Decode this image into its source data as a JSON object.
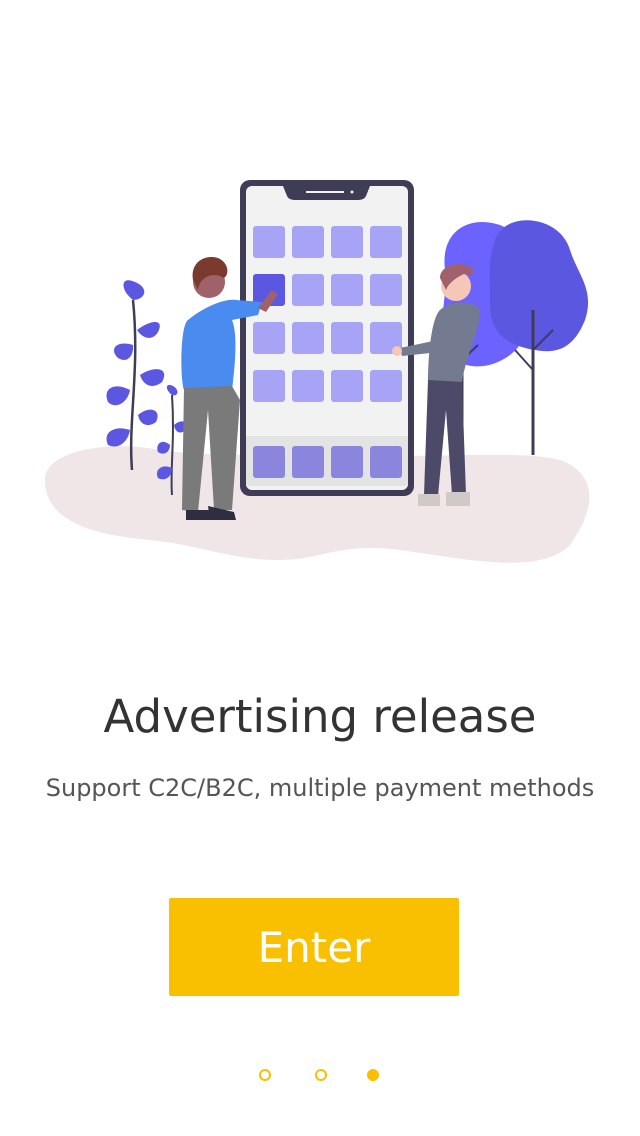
{
  "onboarding": {
    "title": "Advertising release",
    "subtitle": "Support C2C/B2C, multiple payment methods",
    "enter_label": "Enter",
    "page_indicator": {
      "total": 3,
      "active": 3
    }
  },
  "colors": {
    "accent": "#F8C000",
    "illustration_primary": "#6C63FF",
    "title_text": "#333333",
    "subtitle_text": "#555555"
  },
  "icons": [
    "onboarding-illustration",
    "page-dot-icon"
  ]
}
